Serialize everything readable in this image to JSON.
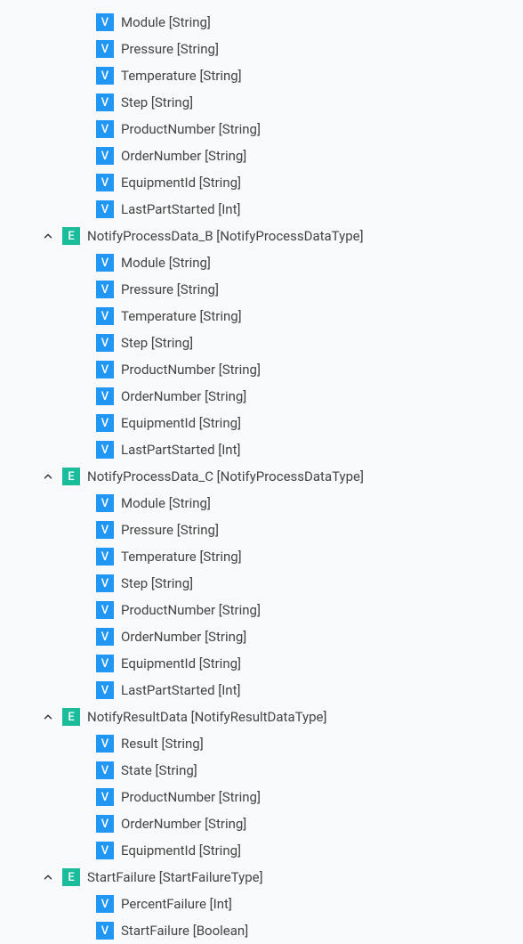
{
  "badges": {
    "v": "V",
    "e": "E"
  },
  "initial_leaves": [
    {
      "name": "Module",
      "type": "String"
    },
    {
      "name": "Pressure",
      "type": "String"
    },
    {
      "name": "Temperature",
      "type": "String"
    },
    {
      "name": "Step",
      "type": "String"
    },
    {
      "name": "ProductNumber",
      "type": "String"
    },
    {
      "name": "OrderNumber",
      "type": "String"
    },
    {
      "name": "EquipmentId",
      "type": "String"
    },
    {
      "name": "LastPartStarted",
      "type": "Int"
    }
  ],
  "groups": [
    {
      "name": "NotifyProcessData_B",
      "type": "NotifyProcessDataType",
      "children": [
        {
          "name": "Module",
          "type": "String"
        },
        {
          "name": "Pressure",
          "type": "String"
        },
        {
          "name": "Temperature",
          "type": "String"
        },
        {
          "name": "Step",
          "type": "String"
        },
        {
          "name": "ProductNumber",
          "type": "String"
        },
        {
          "name": "OrderNumber",
          "type": "String"
        },
        {
          "name": "EquipmentId",
          "type": "String"
        },
        {
          "name": "LastPartStarted",
          "type": "Int"
        }
      ]
    },
    {
      "name": "NotifyProcessData_C",
      "type": "NotifyProcessDataType",
      "children": [
        {
          "name": "Module",
          "type": "String"
        },
        {
          "name": "Pressure",
          "type": "String"
        },
        {
          "name": "Temperature",
          "type": "String"
        },
        {
          "name": "Step",
          "type": "String"
        },
        {
          "name": "ProductNumber",
          "type": "String"
        },
        {
          "name": "OrderNumber",
          "type": "String"
        },
        {
          "name": "EquipmentId",
          "type": "String"
        },
        {
          "name": "LastPartStarted",
          "type": "Int"
        }
      ]
    },
    {
      "name": "NotifyResultData",
      "type": "NotifyResultDataType",
      "children": [
        {
          "name": "Result",
          "type": "String"
        },
        {
          "name": "State",
          "type": "String"
        },
        {
          "name": "ProductNumber",
          "type": "String"
        },
        {
          "name": "OrderNumber",
          "type": "String"
        },
        {
          "name": "EquipmentId",
          "type": "String"
        }
      ]
    },
    {
      "name": "StartFailure",
      "type": "StartFailureType",
      "children": [
        {
          "name": "PercentFailure",
          "type": "Int"
        },
        {
          "name": "StartFailure",
          "type": "Boolean"
        }
      ]
    }
  ]
}
